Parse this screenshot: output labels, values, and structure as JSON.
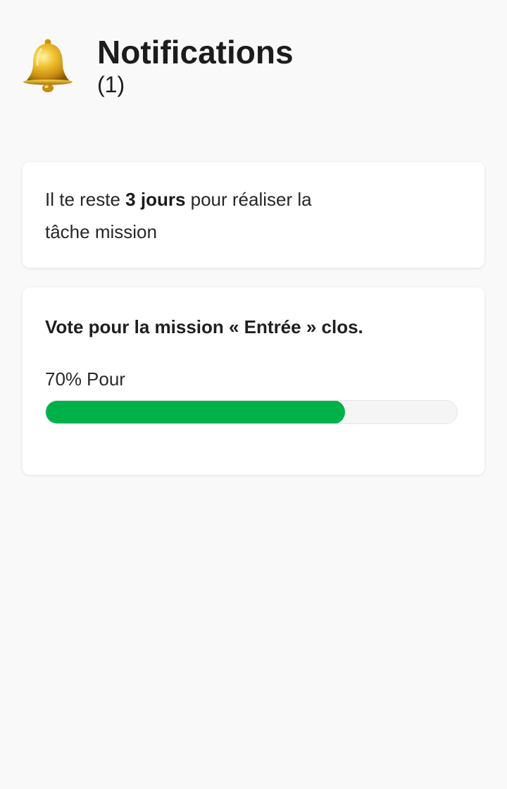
{
  "header": {
    "icon": "bell-icon",
    "title": "Notifications",
    "count": "(1)"
  },
  "notifications": [
    {
      "text_before": "Il te reste ",
      "text_bold": "3 jours",
      "text_after": " pour réaliser la tâche mission"
    },
    {
      "title": "Vote pour la mission « Entrée » clos.",
      "percent_label": "70%",
      "result_label": "Pour",
      "progress_value": 0.727,
      "progress_color": "#00b14a"
    }
  ]
}
